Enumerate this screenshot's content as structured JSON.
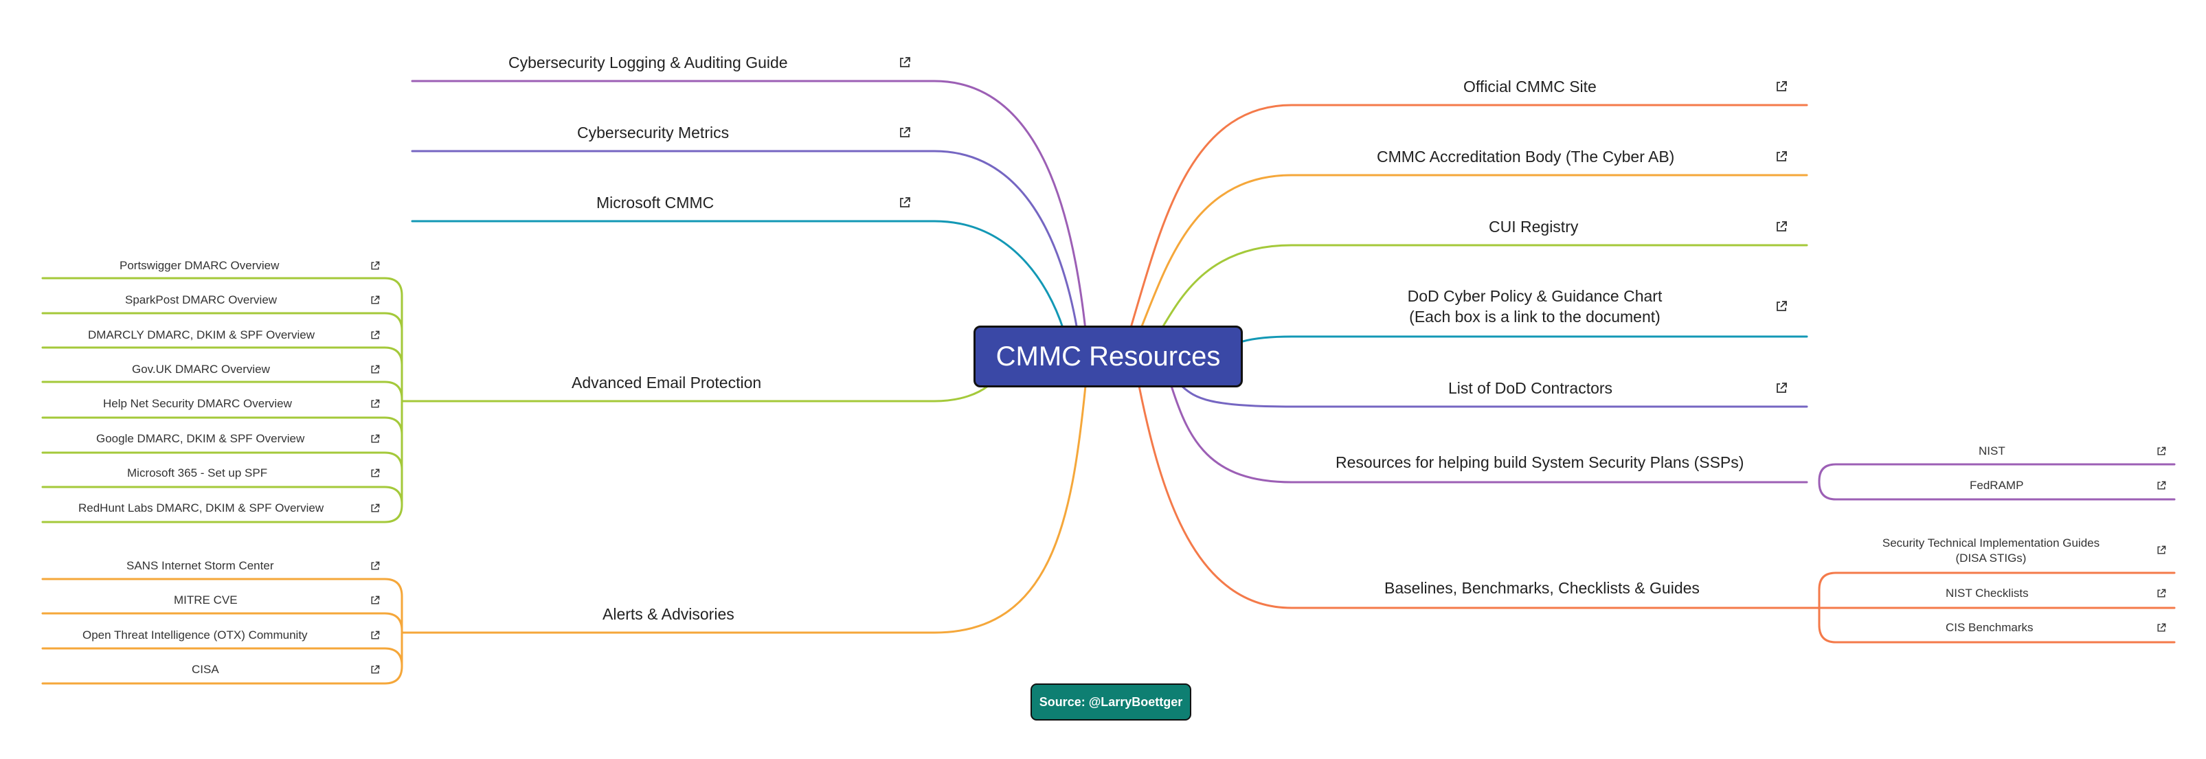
{
  "root": {
    "title": "CMMC Resources"
  },
  "source": "Source: @LarryBoettger",
  "colors": {
    "purple": "#9c5fb5",
    "violet": "#7566c2",
    "teal": "#1398b5",
    "lime": "#a4c93a",
    "orange": "#f5a73a",
    "coral": "#f47a4a",
    "root": "#3a48a6",
    "source": "#0e7f72"
  },
  "icons": {
    "link": "external-link-icon"
  },
  "left": {
    "logging": "Cybersecurity Logging & Auditing Guide",
    "metrics": "Cybersecurity Metrics",
    "microsoft": "Microsoft CMMC",
    "email": {
      "label": "Advanced Email Protection",
      "items": [
        "Portswigger DMARC Overview",
        "SparkPost DMARC Overview",
        "DMARCLY DMARC, DKIM & SPF Overview",
        "Gov.UK DMARC Overview",
        "Help Net Security DMARC Overview",
        "Google DMARC, DKIM & SPF Overview",
        "Microsoft 365 - Set up SPF",
        "RedHunt Labs DMARC, DKIM & SPF Overview"
      ]
    },
    "alerts": {
      "label": "Alerts & Advisories",
      "items": [
        "SANS Internet Storm Center",
        "MITRE CVE",
        "Open Threat Intelligence (OTX) Community",
        "CISA"
      ]
    }
  },
  "right": {
    "official": "Official CMMC Site",
    "accreditation": "CMMC Accreditation Body (The Cyber AB)",
    "cui": "CUI Registry",
    "policy": {
      "line1": "DoD Cyber Policy & Guidance Chart",
      "line2": "(Each box is a link to the document)"
    },
    "contractors": "List of DoD Contractors",
    "ssp": {
      "label": "Resources for helping build System Security Plans (SSPs)",
      "items": [
        "NIST",
        "FedRAMP"
      ]
    },
    "baselines": {
      "label": "Baselines, Benchmarks, Checklists & Guides",
      "items": [
        {
          "line1": "Security Technical Implementation Guides",
          "line2": "(DISA STIGs)"
        },
        "NIST Checklists",
        "CIS Benchmarks"
      ]
    }
  }
}
